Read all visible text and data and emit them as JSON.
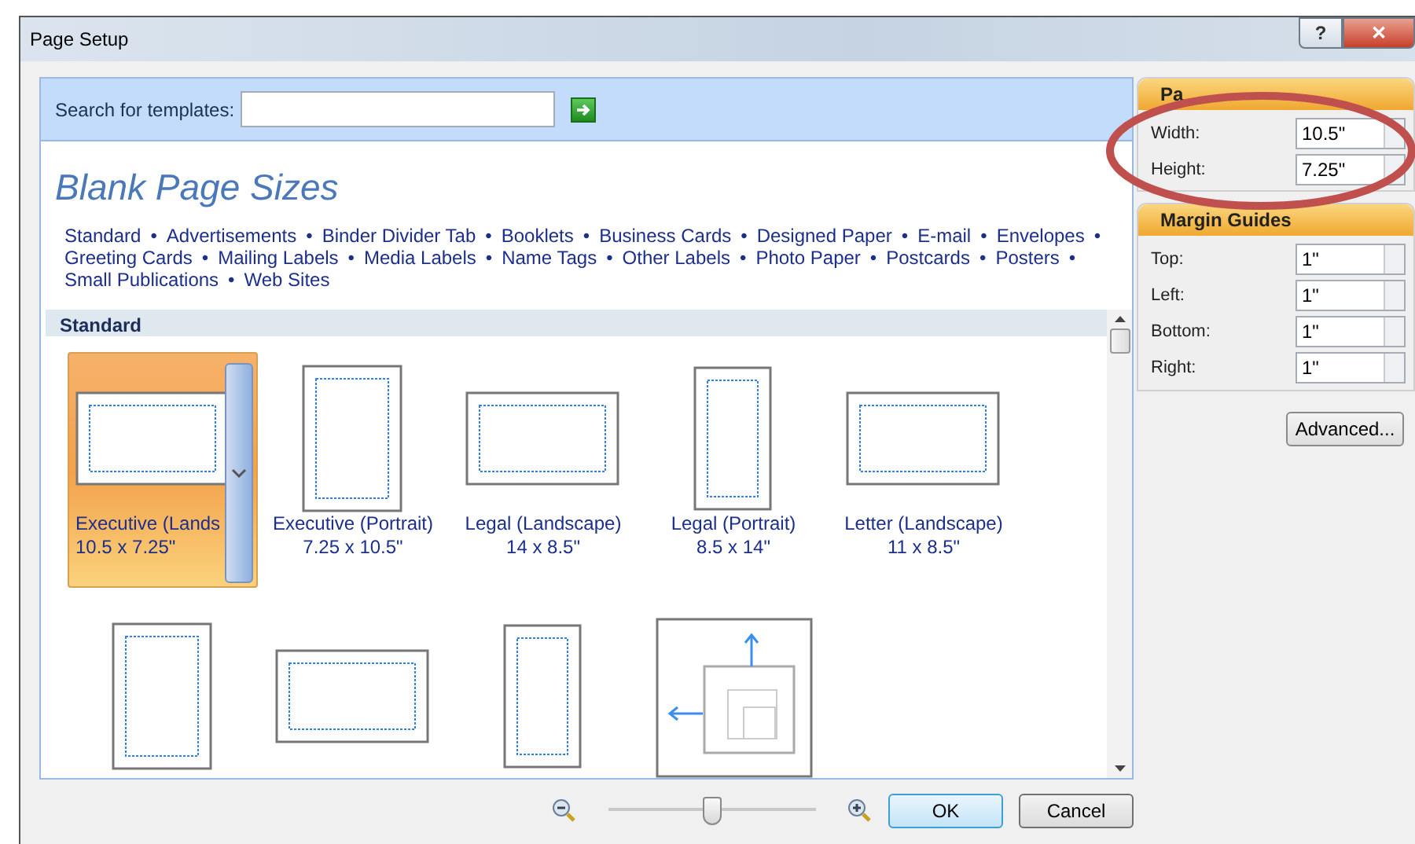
{
  "window": {
    "title": "Page Setup",
    "help": "?",
    "close": "✕"
  },
  "search": {
    "label": "Search for templates:"
  },
  "heading": "Blank Page Sizes",
  "separator": "•",
  "category_lines": [
    [
      "Standard",
      "Advertisements",
      "Binder Divider Tab",
      "Booklets",
      "Business Cards",
      "Designed Paper",
      "E-mail",
      "Envelopes"
    ],
    [
      "Greeting Cards",
      "Mailing Labels",
      "Media Labels",
      "Name Tags",
      "Other Labels",
      "Photo Paper",
      "Postcards",
      "Posters"
    ],
    [
      "Small Publications",
      "Web Sites"
    ]
  ],
  "section": "Standard",
  "templates": [
    {
      "kind": "landscape",
      "name": "Executive (Lands",
      "size": "10.5 x 7.25\"",
      "selected": true
    },
    {
      "kind": "portrait",
      "name": "Executive (Portrait)",
      "size": "7.25 x 10.5\"",
      "selected": false
    },
    {
      "kind": "landscape",
      "name": "Legal (Landscape)",
      "size": "14 x 8.5\"",
      "selected": false
    },
    {
      "kind": "tall",
      "name": "Legal (Portrait)",
      "size": "8.5 x 14\"",
      "selected": false
    },
    {
      "kind": "landscape",
      "name": "Letter (Landscape)",
      "size": "11 x 8.5\"",
      "selected": false
    },
    {
      "kind": "portrait",
      "selected": false
    },
    {
      "kind": "landscape",
      "selected": false
    },
    {
      "kind": "tall",
      "selected": false
    },
    {
      "kind": "custom",
      "selected": false
    }
  ],
  "page_panel": {
    "title": "Pa",
    "fields": [
      {
        "label": "Width:",
        "value": "10.5\""
      },
      {
        "label": "Height:",
        "value": "7.25\""
      }
    ]
  },
  "margin_panel": {
    "title": "Margin Guides",
    "fields": [
      {
        "label": "Top:",
        "value": "1\""
      },
      {
        "label": "Left:",
        "value": "1\""
      },
      {
        "label": "Bottom:",
        "value": "1\""
      },
      {
        "label": "Right:",
        "value": "1\""
      }
    ]
  },
  "advanced": "Advanced...",
  "zoom": {
    "level": 0.5
  },
  "buttons": [
    "OK",
    "Cancel"
  ]
}
